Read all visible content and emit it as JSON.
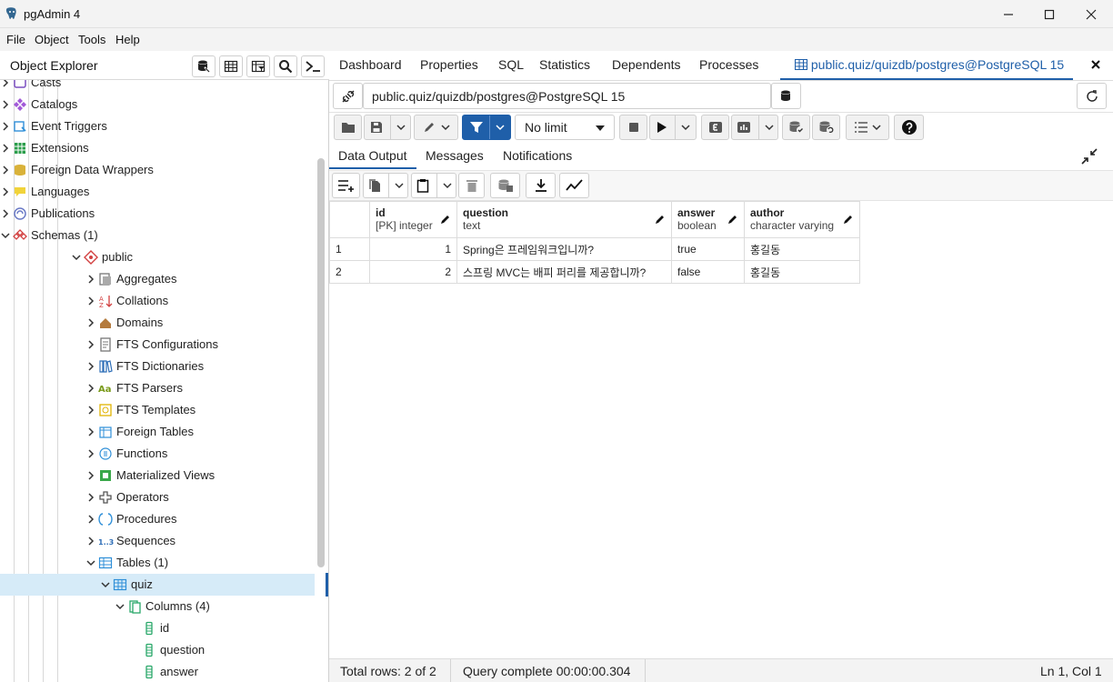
{
  "window": {
    "title": "pgAdmin 4"
  },
  "menu": [
    "File",
    "Object",
    "Tools",
    "Help"
  ],
  "explorer": {
    "title": "Object Explorer",
    "items": [
      {
        "label": "Casts",
        "level": 1,
        "icon": "casts-icon",
        "expanded": false
      },
      {
        "label": "Catalogs",
        "level": 1,
        "icon": "catalogs-icon",
        "expanded": false
      },
      {
        "label": "Event Triggers",
        "level": 1,
        "icon": "event-triggers-icon",
        "expanded": false
      },
      {
        "label": "Extensions",
        "level": 1,
        "icon": "extensions-icon",
        "expanded": false
      },
      {
        "label": "Foreign Data Wrappers",
        "level": 1,
        "icon": "foreign-data-wrappers-icon",
        "expanded": false
      },
      {
        "label": "Languages",
        "level": 1,
        "icon": "languages-icon",
        "expanded": false
      },
      {
        "label": "Publications",
        "level": 1,
        "icon": "publications-icon",
        "expanded": false
      },
      {
        "label": "Schemas (1)",
        "level": 1,
        "icon": "schemas-icon",
        "expanded": true
      },
      {
        "label": "public",
        "level": 2,
        "icon": "schema-icon",
        "expanded": true
      },
      {
        "label": "Aggregates",
        "level": 3,
        "icon": "aggregates-icon",
        "expanded": false
      },
      {
        "label": "Collations",
        "level": 3,
        "icon": "collations-icon",
        "expanded": false
      },
      {
        "label": "Domains",
        "level": 3,
        "icon": "domains-icon",
        "expanded": false
      },
      {
        "label": "FTS Configurations",
        "level": 3,
        "icon": "fts-configurations-icon",
        "expanded": false
      },
      {
        "label": "FTS Dictionaries",
        "level": 3,
        "icon": "fts-dictionaries-icon",
        "expanded": false
      },
      {
        "label": "FTS Parsers",
        "level": 3,
        "icon": "fts-parsers-icon",
        "expanded": false
      },
      {
        "label": "FTS Templates",
        "level": 3,
        "icon": "fts-templates-icon",
        "expanded": false
      },
      {
        "label": "Foreign Tables",
        "level": 3,
        "icon": "foreign-tables-icon",
        "expanded": false
      },
      {
        "label": "Functions",
        "level": 3,
        "icon": "functions-icon",
        "expanded": false
      },
      {
        "label": "Materialized Views",
        "level": 3,
        "icon": "materialized-views-icon",
        "expanded": false
      },
      {
        "label": "Operators",
        "level": 3,
        "icon": "operators-icon",
        "expanded": false
      },
      {
        "label": "Procedures",
        "level": 3,
        "icon": "procedures-icon",
        "expanded": false
      },
      {
        "label": "Sequences",
        "level": 3,
        "icon": "sequences-icon",
        "expanded": false
      },
      {
        "label": "Tables (1)",
        "level": 3,
        "icon": "tables-icon",
        "expanded": true
      },
      {
        "label": "quiz",
        "level": 4,
        "icon": "table-icon",
        "expanded": true,
        "selected": true
      },
      {
        "label": "Columns (4)",
        "level": 5,
        "icon": "columns-icon",
        "expanded": true
      },
      {
        "label": "id",
        "level": 6,
        "icon": "column-icon",
        "leaf": true
      },
      {
        "label": "question",
        "level": 6,
        "icon": "column-icon",
        "leaf": true
      },
      {
        "label": "answer",
        "level": 6,
        "icon": "column-icon",
        "leaf": true
      }
    ],
    "icon_glyphs": {
      "Aa": "Aa",
      "seq": "1..3"
    }
  },
  "tabs": [
    "Dashboard",
    "Properties",
    "SQL",
    "Statistics",
    "Dependents",
    "Processes",
    "public.quiz/quizdb/postgres@PostgreSQL 15"
  ],
  "connection": {
    "value": "public.quiz/quizdb/postgres@PostgreSQL 15"
  },
  "query_toolbar": {
    "limit": "No limit"
  },
  "result_tabs": [
    "Data Output",
    "Messages",
    "Notifications"
  ],
  "grid": {
    "columns": [
      {
        "name": "id",
        "type": "[PK] integer"
      },
      {
        "name": "question",
        "type": "text"
      },
      {
        "name": "answer",
        "type": "boolean"
      },
      {
        "name": "author",
        "type": "character varying"
      }
    ],
    "rows": [
      {
        "rownum": "1",
        "id": "1",
        "question": "Spring은 프레임워크입니까?",
        "answer": "true",
        "author": "홍길동"
      },
      {
        "rownum": "2",
        "id": "2",
        "question": "스프링 MVC는 배피 퍼리를 제공합니까?",
        "answer": "false",
        "author": "홍길동"
      }
    ]
  },
  "status": {
    "rows": "Total rows: 2 of 2",
    "query": "Query complete 00:00:00.304",
    "cursor": "Ln 1, Col 1"
  },
  "colors": {
    "accent": "#1f5fa9",
    "selected_row": "#d6ebf8",
    "filter_button": "#1f5fa9"
  }
}
